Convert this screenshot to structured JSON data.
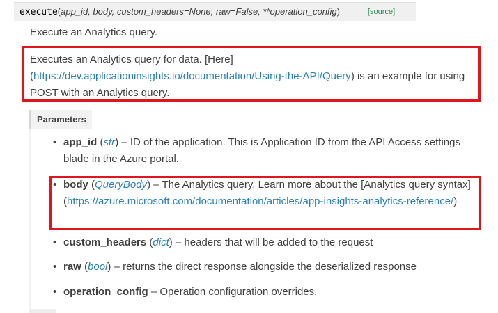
{
  "signature": {
    "name": "execute",
    "params": "app_id, body, custom_headers=None, raw=False, **operation_config",
    "source_label": "[source]"
  },
  "summary": "Execute an Analytics query.",
  "description": {
    "text_before": "Executes an Analytics query for data. [Here] (",
    "link": "https://dev.applicationinsights.io/documentation/Using-the-API/Query",
    "text_after": ") is an example for using POST with an Analytics query."
  },
  "parameters_label": "Parameters",
  "parameters": [
    {
      "name": "app_id",
      "type": "str",
      "description": " – ID of the application. This is Application ID from the API Access settings blade in the Azure portal."
    },
    {
      "name": "body",
      "type": "QueryBody",
      "description": " – The Analytics query. Learn more about the [Analytics query syntax](",
      "link": "https://azure.microsoft.com/documentation/articles/app-insights-analytics-reference/",
      "description_after": ")"
    },
    {
      "name": "custom_headers",
      "type": "dict",
      "description": " – headers that will be added to the request"
    },
    {
      "name": "raw",
      "type": "bool",
      "description": " – returns the direct response alongside the deserialized response"
    },
    {
      "name": "operation_config",
      "description": " – Operation configuration overrides."
    }
  ],
  "colors": {
    "highlight_border": "#e0161e",
    "link": "#2980b9",
    "source_link": "#2e8b57"
  }
}
